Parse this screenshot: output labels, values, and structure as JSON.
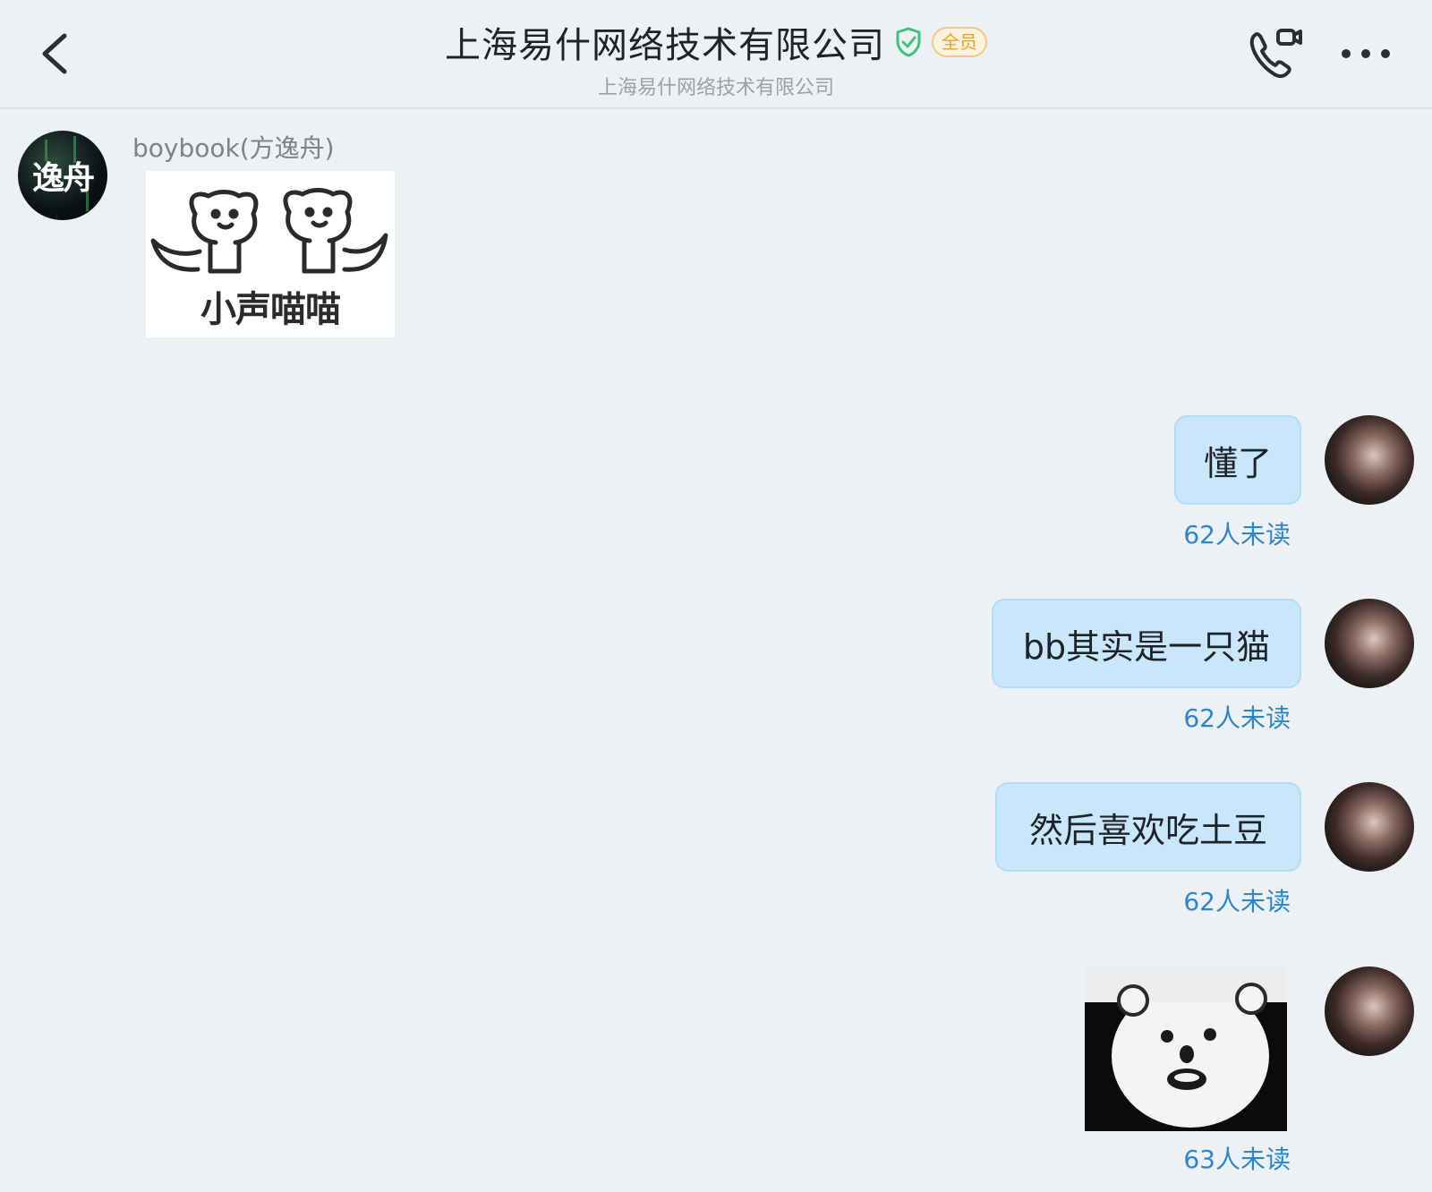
{
  "header": {
    "title": "上海易什网络技术有限公司",
    "badge": "全员",
    "subtitle": "上海易什网络技术有限公司"
  },
  "icons": {
    "back": "chevron-left-icon",
    "verified": "shield-check-icon",
    "call": "video-call-icon",
    "more": "more-horizontal-icon"
  },
  "colors": {
    "bubble": "#c9e7fb",
    "unread": "#2a86d0",
    "badge": "#f4a01c",
    "verified": "#3cc47c"
  },
  "messages": [
    {
      "sender": "boybook(方逸舟)",
      "avatar_text": "逸舟",
      "type": "sticker",
      "sticker_caption": "小声喵喵"
    },
    {
      "type": "text",
      "text": "懂了",
      "unread": "62人未读"
    },
    {
      "type": "text",
      "text": "bb其实是一只猫",
      "unread": "62人未读"
    },
    {
      "type": "text",
      "text": "然后喜欢吃土豆",
      "unread": "62人未读"
    },
    {
      "type": "sticker",
      "unread": "63人未读"
    }
  ]
}
